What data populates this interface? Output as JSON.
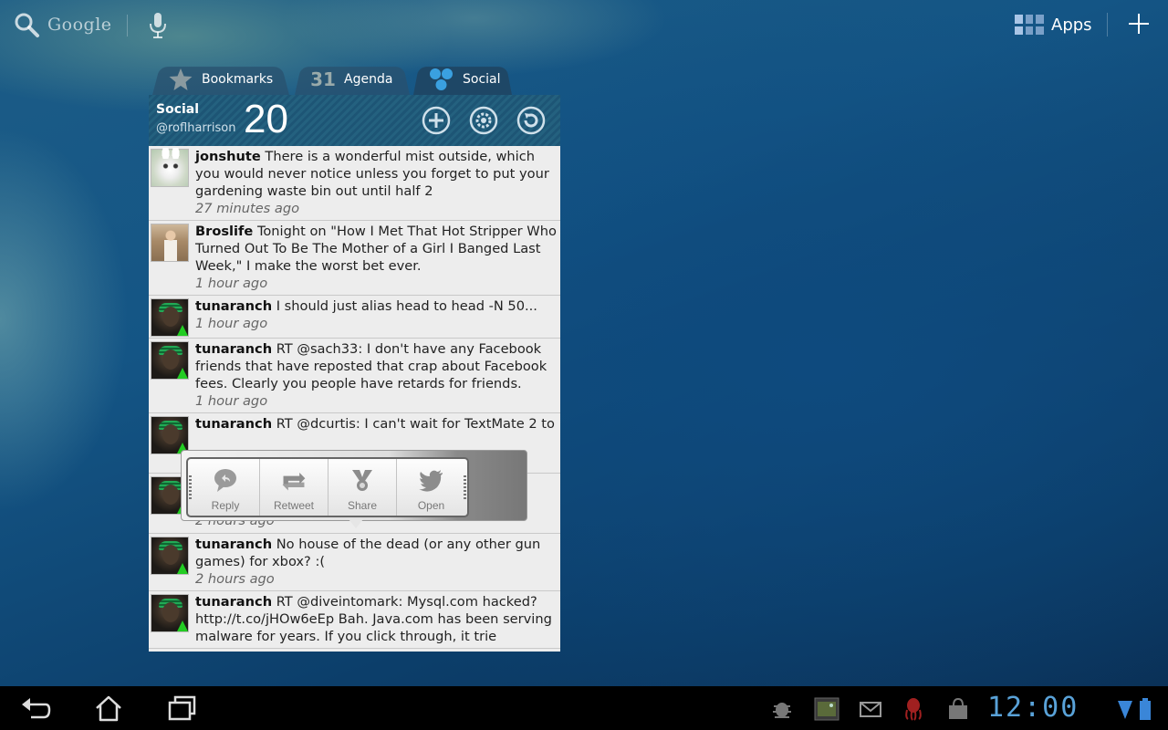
{
  "topbar": {
    "search_label": "Google",
    "apps_label": "Apps"
  },
  "widget": {
    "tabs": [
      {
        "label": "Bookmarks",
        "icon": "star-icon"
      },
      {
        "label": "Agenda",
        "icon": "calendar-icon",
        "icon_text": "31"
      },
      {
        "label": "Social",
        "icon": "social-icon",
        "active": true
      }
    ],
    "header": {
      "title": "Social",
      "user": "@roflharrison",
      "count": "20"
    },
    "feed": [
      {
        "user": "jonshute",
        "text": "There is a wonderful mist outside, which you would never notice unless you forget to put your gardening waste bin out until half 2",
        "time": "27 minutes ago"
      },
      {
        "user": "Broslife",
        "text": "Tonight on \"How I Met That Hot Stripper Who Turned Out To Be The Mother of a Girl I Banged Last Week,\" I make the worst bet ever.",
        "time": "1 hour ago"
      },
      {
        "user": "tunaranch",
        "text": "I should just alias head to head -N 50...",
        "time": "1 hour ago"
      },
      {
        "user": "tunaranch",
        "text": "RT @sach33: I don't have any Facebook friends that have reposted that crap about Facebook fees. Clearly you people have retards for friends.",
        "time": "1 hour ago"
      },
      {
        "user": "tunaranch",
        "text": "RT @dcurtis: I can't wait for TextMate 2 to",
        "time": ""
      },
      {
        "user": "",
        "text": "",
        "time": "2 hours ago"
      },
      {
        "user": "tunaranch",
        "text": "No house of the dead (or any other gun games) for xbox? :(",
        "time": "2 hours ago"
      },
      {
        "user": "tunaranch",
        "text": "RT @diveintomark: Mysql.com hacked? http://t.co/jHOw6eEp Bah. Java.com has been serving malware for years. If you click through, it trie",
        "time": ""
      }
    ]
  },
  "quick_actions": [
    {
      "label": "Reply",
      "icon": "reply-icon"
    },
    {
      "label": "Retweet",
      "icon": "retweet-icon"
    },
    {
      "label": "Share",
      "icon": "share-icon"
    },
    {
      "label": "Open",
      "icon": "twitter-bird-icon"
    }
  ],
  "systembar": {
    "clock": "12:00"
  },
  "colors": {
    "accent_blue": "#59a2d8",
    "header_teal": "#1d5575",
    "feed_bg": "#ededed"
  }
}
